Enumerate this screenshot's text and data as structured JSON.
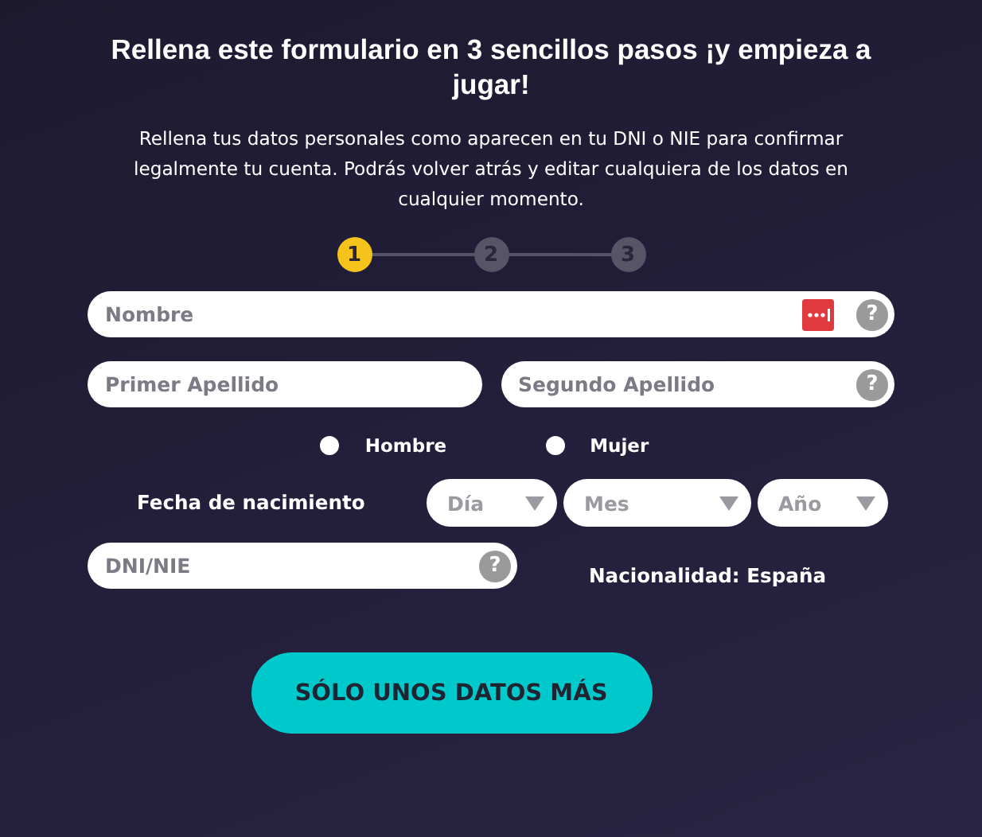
{
  "title": "Rellena este formulario en 3 sencillos pasos ¡y empieza a jugar!",
  "intro": "Rellena tus datos personales como aparecen en tu DNI o NIE para confirmar legalmente tu cuenta. Podrás volver atrás y editar cualquiera de los datos en cualquier momento.",
  "steps": [
    {
      "label": "1",
      "selected": true
    },
    {
      "label": "2",
      "selected": false
    },
    {
      "label": "3",
      "selected": false
    }
  ],
  "name_field": {
    "placeholder": "Nombre",
    "help": "?"
  },
  "surname_fields": [
    {
      "placeholder": "Primer Apellido"
    },
    {
      "placeholder": "Segundo Apellido",
      "help": "?"
    }
  ],
  "gender": [
    {
      "label": "Hombre",
      "selected": false
    },
    {
      "label": "Mujer",
      "selected": false
    }
  ],
  "birth_date": {
    "label": "Fecha de nacimiento",
    "selects": [
      {
        "placeholder": "Día"
      },
      {
        "placeholder": "Mes"
      },
      {
        "placeholder": "Año"
      }
    ]
  },
  "id_field": {
    "placeholder": "DNI/NIE",
    "help": "?"
  },
  "nationality": "Nacionalidad: España",
  "submit": "SÓLO UNOS DATOS MÁS"
}
